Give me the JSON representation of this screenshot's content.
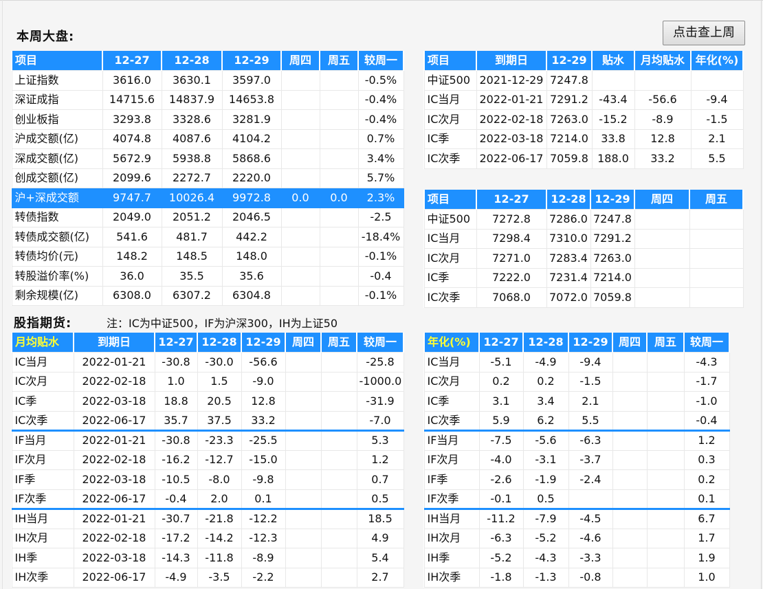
{
  "page": {
    "title": "本周大盘:",
    "button": "点击查上周",
    "futures_title": "股指期货:",
    "futures_note": "注：IC为中证500，IF为沪深300，IH为上证50"
  },
  "market": {
    "headers": [
      "项目",
      "12-27",
      "12-28",
      "12-29",
      "周四",
      "周五",
      "较周一"
    ],
    "rows": [
      [
        "上证指数",
        "3616.0",
        "3630.1",
        "3597.0",
        "",
        "",
        "-0.5%"
      ],
      [
        "深证成指",
        "14715.6",
        "14837.9",
        "14653.8",
        "",
        "",
        "-0.4%"
      ],
      [
        "创业板指",
        "3293.8",
        "3328.6",
        "3281.9",
        "",
        "",
        "-0.4%"
      ],
      [
        "沪成交额(亿)",
        "4074.8",
        "4087.6",
        "4104.2",
        "",
        "",
        "0.7%"
      ],
      [
        "深成交额(亿)",
        "5672.9",
        "5938.8",
        "5868.6",
        "",
        "",
        "3.4%"
      ],
      [
        "创成交额(亿)",
        "2099.6",
        "2272.7",
        "2220.0",
        "",
        "",
        "5.7%"
      ],
      [
        "沪+深成交额",
        "9747.7",
        "10026.4",
        "9972.8",
        "0.0",
        "0.0",
        "2.3%"
      ],
      [
        "转债指数",
        "2049.0",
        "2051.2",
        "2046.5",
        "",
        "",
        "-2.5"
      ],
      [
        "转债成交额(亿)",
        "541.6",
        "481.7",
        "442.2",
        "",
        "",
        "-18.4%"
      ],
      [
        "转债均价(元)",
        "148.2",
        "148.5",
        "148.0",
        "",
        "",
        "-0.1%"
      ],
      [
        "转股溢价率(%)",
        "36.0",
        "35.5",
        "35.6",
        "",
        "",
        "-0.4"
      ],
      [
        "剩余规模(亿)",
        "6308.0",
        "6307.2",
        "6304.8",
        "",
        "",
        "-0.1%"
      ]
    ]
  },
  "basis": {
    "headers": [
      "项目",
      "到期日",
      "12-29",
      "贴水",
      "月均贴水",
      "年化(%)"
    ],
    "rows": [
      [
        "中证500",
        "2021-12-29",
        "7247.8",
        "",
        "",
        ""
      ],
      [
        "IC当月",
        "2022-01-21",
        "7291.2",
        "-43.4",
        "-56.6",
        "-9.4"
      ],
      [
        "IC次月",
        "2022-02-18",
        "7263.0",
        "-15.2",
        "-8.9",
        "-1.5"
      ],
      [
        "IC季",
        "2022-03-18",
        "7214.0",
        "33.8",
        "12.8",
        "2.1"
      ],
      [
        "IC次季",
        "2022-06-17",
        "7059.8",
        "188.0",
        "33.2",
        "5.5"
      ]
    ]
  },
  "prices": {
    "headers": [
      "项目",
      "12-27",
      "12-28",
      "12-29",
      "周四",
      "周五"
    ],
    "rows": [
      [
        "中证500",
        "7272.8",
        "7286.0",
        "7247.8",
        "",
        ""
      ],
      [
        "IC当月",
        "7298.4",
        "7310.0",
        "7291.2",
        "",
        ""
      ],
      [
        "IC次月",
        "7271.0",
        "7283.4",
        "7263.0",
        "",
        ""
      ],
      [
        "IC季",
        "7222.0",
        "7231.4",
        "7214.0",
        "",
        ""
      ],
      [
        "IC次季",
        "7068.0",
        "7072.0",
        "7059.8",
        "",
        ""
      ]
    ]
  },
  "monthly": {
    "headers": [
      "月均贴水",
      "到期日",
      "12-27",
      "12-28",
      "12-29",
      "周四",
      "周五",
      "较周一"
    ],
    "rows": [
      [
        "IC当月",
        "2022-01-21",
        "-30.8",
        "-30.0",
        "-56.6",
        "",
        "",
        "-25.8"
      ],
      [
        "IC次月",
        "2022-02-18",
        "1.0",
        "1.5",
        "-9.0",
        "",
        "",
        "-1000.0"
      ],
      [
        "IC季",
        "2022-03-18",
        "18.8",
        "20.5",
        "12.8",
        "",
        "",
        "-31.9"
      ],
      [
        "IC次季",
        "2022-06-17",
        "35.7",
        "37.5",
        "33.2",
        "",
        "",
        "-7.0"
      ],
      [
        "IF当月",
        "2022-01-21",
        "-30.8",
        "-23.3",
        "-25.5",
        "",
        "",
        "5.3"
      ],
      [
        "IF次月",
        "2022-02-18",
        "-16.2",
        "-12.7",
        "-15.0",
        "",
        "",
        "1.2"
      ],
      [
        "IF季",
        "2022-03-18",
        "-10.5",
        "-8.0",
        "-9.8",
        "",
        "",
        "0.7"
      ],
      [
        "IF次季",
        "2022-06-17",
        "-0.4",
        "2.0",
        "0.1",
        "",
        "",
        "0.5"
      ],
      [
        "IH当月",
        "2022-01-21",
        "-30.7",
        "-21.8",
        "-12.2",
        "",
        "",
        "18.5"
      ],
      [
        "IH次月",
        "2022-02-18",
        "-17.2",
        "-14.2",
        "-12.3",
        "",
        "",
        "4.9"
      ],
      [
        "IH季",
        "2022-03-18",
        "-14.3",
        "-11.8",
        "-8.9",
        "",
        "",
        "5.4"
      ],
      [
        "IH次季",
        "2022-06-17",
        "-4.9",
        "-3.5",
        "-2.2",
        "",
        "",
        "2.7"
      ]
    ]
  },
  "annualized": {
    "headers": [
      "年化(%)",
      "12-27",
      "12-28",
      "12-29",
      "周四",
      "周五",
      "较周一"
    ],
    "rows": [
      [
        "IC当月",
        "-5.1",
        "-4.9",
        "-9.4",
        "",
        "",
        "-4.3"
      ],
      [
        "IC次月",
        "0.2",
        "0.2",
        "-1.5",
        "",
        "",
        "-1.7"
      ],
      [
        "IC季",
        "3.1",
        "3.4",
        "2.1",
        "",
        "",
        "-1.0"
      ],
      [
        "IC次季",
        "5.9",
        "6.2",
        "5.5",
        "",
        "",
        "-0.4"
      ],
      [
        "IF当月",
        "-7.5",
        "-5.6",
        "-6.3",
        "",
        "",
        "1.2"
      ],
      [
        "IF次月",
        "-4.0",
        "-3.1",
        "-3.7",
        "",
        "",
        "0.3"
      ],
      [
        "IF季",
        "-2.6",
        "-1.9",
        "-2.4",
        "",
        "",
        "0.2"
      ],
      [
        "IF次季",
        "-0.1",
        "0.5",
        "",
        "",
        "",
        "0.1"
      ],
      [
        "IH当月",
        "-11.2",
        "-7.9",
        "-4.5",
        "",
        "",
        "6.7"
      ],
      [
        "IH次月",
        "-6.3",
        "-5.2",
        "-4.6",
        "",
        "",
        "1.7"
      ],
      [
        "IH季",
        "-5.2",
        "-4.3",
        "-3.3",
        "",
        "",
        "1.9"
      ],
      [
        "IH次季",
        "-1.8",
        "-1.3",
        "-0.8",
        "",
        "",
        "1.0"
      ]
    ]
  }
}
